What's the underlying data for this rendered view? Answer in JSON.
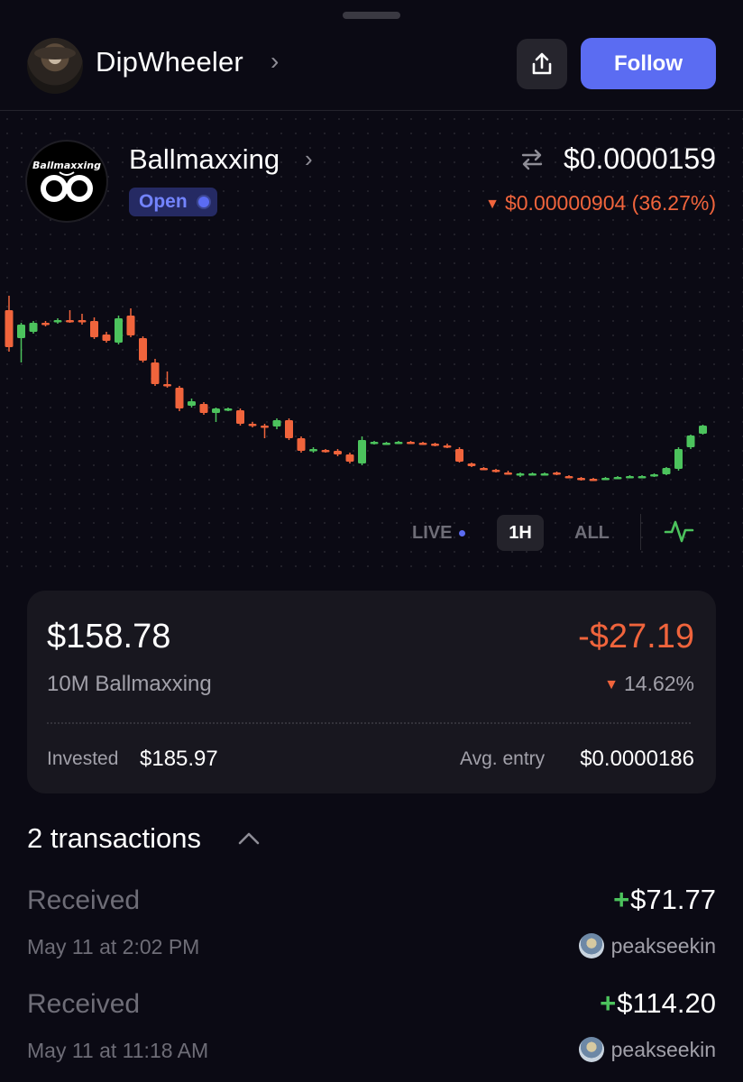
{
  "header": {
    "username": "DipWheeler",
    "follow_label": "Follow"
  },
  "token": {
    "name": "Ballmaxxing",
    "logo_text": "Ballmaxxing",
    "status": "Open",
    "price": "$0.0000159",
    "change": "$0.00000904 (36.27%)",
    "change_direction": "down",
    "colors": {
      "up": "#4cc35d",
      "down": "#f0643c",
      "accent": "#5b6cf2"
    }
  },
  "timeframes": {
    "live": "LIVE",
    "h1": "1H",
    "all": "ALL",
    "selected": "1H"
  },
  "position": {
    "value": "$158.78",
    "pnl": "-$27.19",
    "amount": "10M Ballmaxxing",
    "pnl_pct": "14.62%",
    "invested_label": "Invested",
    "invested_value": "$185.97",
    "entry_label": "Avg. entry",
    "entry_value": "$0.0000186"
  },
  "transactions": {
    "header": "2 transactions",
    "items": [
      {
        "type": "Received",
        "time": "May 11 at 2:02 PM",
        "amount": "$71.77",
        "user": "peakseekin"
      },
      {
        "type": "Received",
        "time": "May 11 at 11:18 AM",
        "amount": "$114.20",
        "user": "peakseekin"
      }
    ]
  },
  "chart_data": {
    "type": "candlestick",
    "timeframe": "1H",
    "candles": [
      {
        "o": 44,
        "c": 85,
        "h": 28,
        "l": 90,
        "dir": "down"
      },
      {
        "o": 75,
        "c": 60,
        "h": 58,
        "l": 102,
        "dir": "up"
      },
      {
        "o": 68,
        "c": 58,
        "h": 56,
        "l": 70,
        "dir": "up"
      },
      {
        "o": 58,
        "c": 60,
        "h": 56,
        "l": 62,
        "dir": "down"
      },
      {
        "o": 57,
        "c": 55,
        "h": 53,
        "l": 59,
        "dir": "up"
      },
      {
        "o": 55,
        "c": 56,
        "h": 44,
        "l": 58,
        "dir": "down"
      },
      {
        "o": 55,
        "c": 57,
        "h": 48,
        "l": 60,
        "dir": "down"
      },
      {
        "o": 56,
        "c": 74,
        "h": 52,
        "l": 76,
        "dir": "down"
      },
      {
        "o": 71,
        "c": 78,
        "h": 68,
        "l": 80,
        "dir": "down"
      },
      {
        "o": 80,
        "c": 53,
        "h": 50,
        "l": 82,
        "dir": "up"
      },
      {
        "o": 50,
        "c": 72,
        "h": 42,
        "l": 74,
        "dir": "down"
      },
      {
        "o": 75,
        "c": 100,
        "h": 73,
        "l": 102,
        "dir": "down"
      },
      {
        "o": 102,
        "c": 126,
        "h": 98,
        "l": 128,
        "dir": "down"
      },
      {
        "o": 126,
        "c": 128,
        "h": 112,
        "l": 130,
        "dir": "down"
      },
      {
        "o": 130,
        "c": 153,
        "h": 128,
        "l": 156,
        "dir": "down"
      },
      {
        "o": 145,
        "c": 150,
        "h": 142,
        "l": 152,
        "dir": "up"
      },
      {
        "o": 148,
        "c": 158,
        "h": 146,
        "l": 160,
        "dir": "down"
      },
      {
        "o": 158,
        "c": 153,
        "h": 152,
        "l": 168,
        "dir": "up"
      },
      {
        "o": 153,
        "c": 154,
        "h": 152,
        "l": 156,
        "dir": "up"
      },
      {
        "o": 155,
        "c": 170,
        "h": 153,
        "l": 172,
        "dir": "down"
      },
      {
        "o": 170,
        "c": 172,
        "h": 168,
        "l": 174,
        "dir": "down"
      },
      {
        "o": 172,
        "c": 174,
        "h": 170,
        "l": 186,
        "dir": "down"
      },
      {
        "o": 173,
        "c": 166,
        "h": 164,
        "l": 176,
        "dir": "up"
      },
      {
        "o": 166,
        "c": 186,
        "h": 164,
        "l": 188,
        "dir": "down"
      },
      {
        "o": 186,
        "c": 200,
        "h": 184,
        "l": 202,
        "dir": "down"
      },
      {
        "o": 200,
        "c": 198,
        "h": 196,
        "l": 202,
        "dir": "up"
      },
      {
        "o": 199,
        "c": 200,
        "h": 198,
        "l": 202,
        "dir": "down"
      },
      {
        "o": 200,
        "c": 204,
        "h": 198,
        "l": 206,
        "dir": "down"
      },
      {
        "o": 204,
        "c": 212,
        "h": 202,
        "l": 214,
        "dir": "down"
      },
      {
        "o": 214,
        "c": 188,
        "h": 184,
        "l": 216,
        "dir": "up"
      },
      {
        "o": 190,
        "c": 191,
        "h": 189,
        "l": 193,
        "dir": "up"
      },
      {
        "o": 191,
        "c": 192,
        "h": 190,
        "l": 193,
        "dir": "up"
      },
      {
        "o": 191,
        "c": 190,
        "h": 189,
        "l": 192,
        "dir": "up"
      },
      {
        "o": 190,
        "c": 191,
        "h": 189,
        "l": 192,
        "dir": "down"
      },
      {
        "o": 191,
        "c": 192,
        "h": 190,
        "l": 193,
        "dir": "down"
      },
      {
        "o": 192,
        "c": 194,
        "h": 191,
        "l": 195,
        "dir": "down"
      },
      {
        "o": 194,
        "c": 196,
        "h": 192,
        "l": 197,
        "dir": "down"
      },
      {
        "o": 198,
        "c": 212,
        "h": 196,
        "l": 213,
        "dir": "down"
      },
      {
        "o": 214,
        "c": 217,
        "h": 213,
        "l": 218,
        "dir": "down"
      },
      {
        "o": 219,
        "c": 220,
        "h": 218,
        "l": 221,
        "dir": "down"
      },
      {
        "o": 221,
        "c": 223,
        "h": 220,
        "l": 224,
        "dir": "down"
      },
      {
        "o": 224,
        "c": 225,
        "h": 222,
        "l": 226,
        "dir": "down"
      },
      {
        "o": 225,
        "c": 227,
        "h": 224,
        "l": 229,
        "dir": "up"
      },
      {
        "o": 226,
        "c": 225,
        "h": 224,
        "l": 227,
        "dir": "up"
      },
      {
        "o": 225,
        "c": 225,
        "h": 224,
        "l": 226,
        "dir": "up"
      },
      {
        "o": 224,
        "c": 226,
        "h": 223,
        "l": 227,
        "dir": "down"
      },
      {
        "o": 228,
        "c": 229,
        "h": 227,
        "l": 230,
        "dir": "down"
      },
      {
        "o": 230,
        "c": 232,
        "h": 229,
        "l": 233,
        "dir": "down"
      },
      {
        "o": 231,
        "c": 231,
        "h": 230,
        "l": 232,
        "dir": "down"
      },
      {
        "o": 231,
        "c": 230,
        "h": 229,
        "l": 232,
        "dir": "up"
      },
      {
        "o": 230,
        "c": 229,
        "h": 228,
        "l": 231,
        "dir": "up"
      },
      {
        "o": 229,
        "c": 228,
        "h": 227,
        "l": 230,
        "dir": "up"
      },
      {
        "o": 228,
        "c": 228,
        "h": 227,
        "l": 229,
        "dir": "up"
      },
      {
        "o": 228,
        "c": 226,
        "h": 225,
        "l": 229,
        "dir": "up"
      },
      {
        "o": 226,
        "c": 219,
        "h": 218,
        "l": 227,
        "dir": "up"
      },
      {
        "o": 220,
        "c": 198,
        "h": 196,
        "l": 222,
        "dir": "up"
      },
      {
        "o": 196,
        "c": 183,
        "h": 182,
        "l": 198,
        "dir": "up"
      },
      {
        "o": 181,
        "c": 172,
        "h": 171,
        "l": 182,
        "dir": "up"
      }
    ]
  }
}
